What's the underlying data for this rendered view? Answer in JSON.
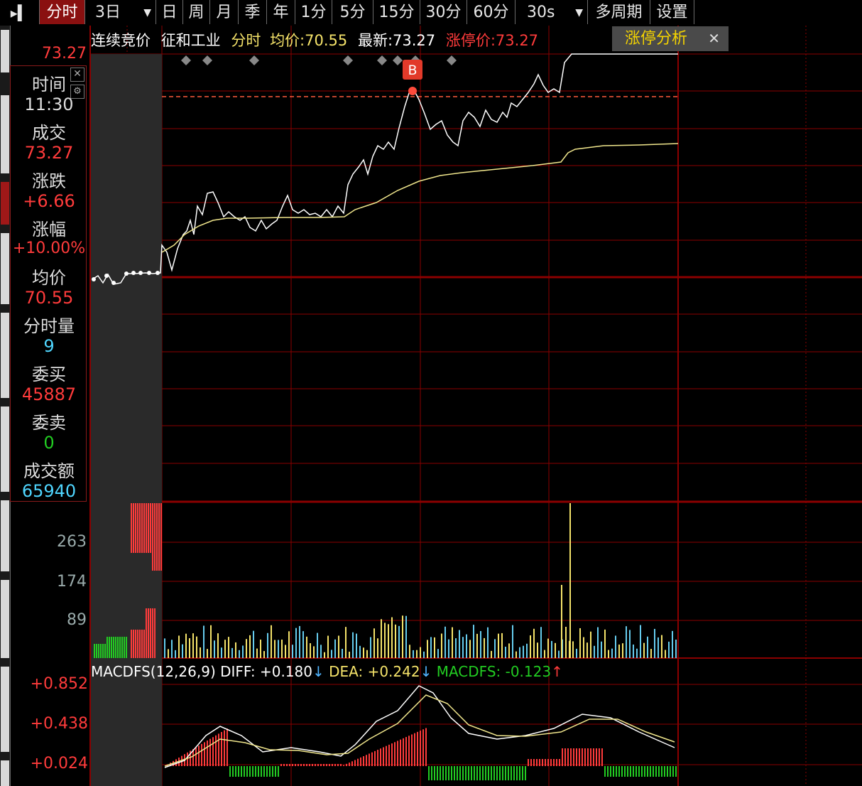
{
  "toolbar": {
    "items": [
      "分时",
      "3日",
      "日",
      "周",
      "月",
      "季",
      "年",
      "1分",
      "5分",
      "15分",
      "30分",
      "60分",
      "30s",
      "多周期",
      "设置"
    ]
  },
  "info": {
    "auction": "连续竞价",
    "stock_name": "征和工业",
    "mode": "分时",
    "avg_label": "均价:",
    "avg_value": "70.55",
    "latest_label": "最新:",
    "latest_value": "73.27",
    "limit_label": "涨停价:",
    "limit_value": "73.27",
    "analysis_button": "涨停分析",
    "close_glyph": "✕"
  },
  "panel": {
    "time_label": "时间",
    "time_value": "11:30",
    "deal_label": "成交",
    "deal_value": "73.27",
    "change_label": "涨跌",
    "change_value": "+6.66",
    "pct_label": "涨幅",
    "pct_value": "+10.00%",
    "avg_label": "均价",
    "avg_value": "70.55",
    "vol_label": "分时量",
    "vol_value": "9",
    "bid_label": "委买",
    "bid_value": "45887",
    "ask_label": "委卖",
    "ask_value": "0",
    "amount_label": "成交额",
    "amount_value": "65940"
  },
  "axes": {
    "price_top": "73.27",
    "vol_ticks": [
      "263",
      "174",
      "89"
    ],
    "macd_ticks": [
      "+0.852",
      "+0.438",
      "+0.024"
    ]
  },
  "macd": {
    "name": "MACDFS(12,26,9)",
    "diff": "DIFF: +0.180",
    "diff_arrow": "↓",
    "dea": "DEA: +0.242",
    "dea_arrow": "↓",
    "macdfs": "MACDFS: -0.123",
    "macdfs_arrow": "↑"
  },
  "marker": {
    "label": "B"
  },
  "colors": {
    "grid": "#8b0000",
    "price": "#ffffff",
    "avg": "#f0e68c",
    "up": "#ff3b3b",
    "down": "#22cc22",
    "neutral_vol": "#66ccee",
    "yellow": "#f5e36a"
  }
}
